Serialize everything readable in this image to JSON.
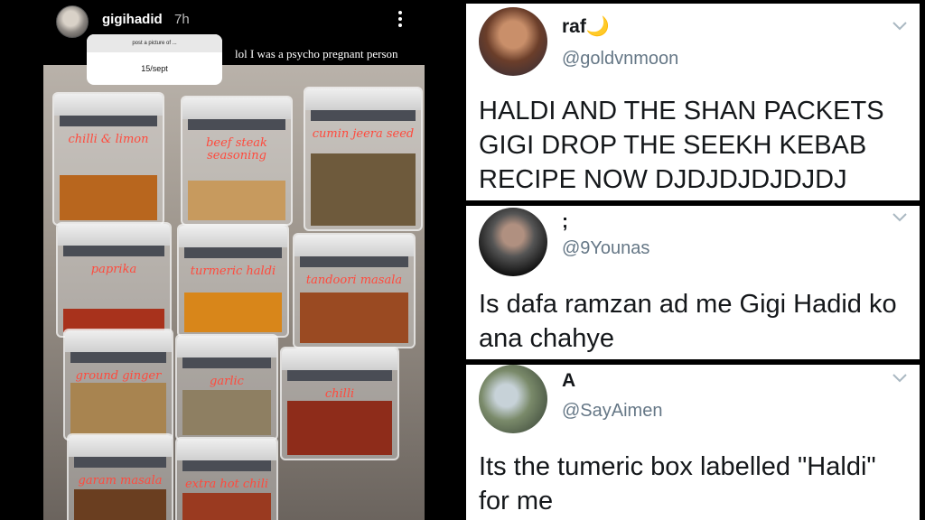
{
  "story": {
    "username": "gigihadid",
    "time": "7h",
    "question": {
      "prompt": "post a picture of ...",
      "answer": "15/sept"
    },
    "caption": "lol I was a psycho pregnant person",
    "jars": [
      {
        "label": "chilli & limon",
        "spice_color": "#b8661e"
      },
      {
        "label": "beef steak seasoning",
        "spice_color": "#c79a5e"
      },
      {
        "label": "cumin jeera seed",
        "spice_color": "#6e5a3c"
      },
      {
        "label": "paprika",
        "spice_color": "#a8321c"
      },
      {
        "label": "turmeric haldi",
        "spice_color": "#d8861a"
      },
      {
        "label": "tandoori masala",
        "spice_color": "#9a4a22"
      },
      {
        "label": "ground ginger",
        "spice_color": "#a88450"
      },
      {
        "label": "garlic",
        "spice_color": "#8e7f62"
      },
      {
        "label": "chilli",
        "spice_color": "#8e2c1a"
      },
      {
        "label": "garam masala",
        "spice_color": "#6a3e20"
      },
      {
        "label": "extra hot chili",
        "spice_color": "#9a3a20"
      }
    ]
  },
  "tweets": [
    {
      "name": "raf🌙",
      "handle": "@goldvnmoon",
      "text": "HALDI AND THE SHAN PACKETS GIGI DROP THE SEEKH KEBAB RECIPE NOW DJDJDJDJDJDJ"
    },
    {
      "name": ";",
      "handle": "@9Younas",
      "text": "Is dafa ramzan ad me Gigi Hadid ko ana chahye"
    },
    {
      "name": "A",
      "handle": "@SayAimen",
      "text": "Its the tumeric box labelled \"Haldi\" for me"
    }
  ],
  "colors": {
    "label_red": "#ff4a3d",
    "handle_gray": "#657786"
  }
}
